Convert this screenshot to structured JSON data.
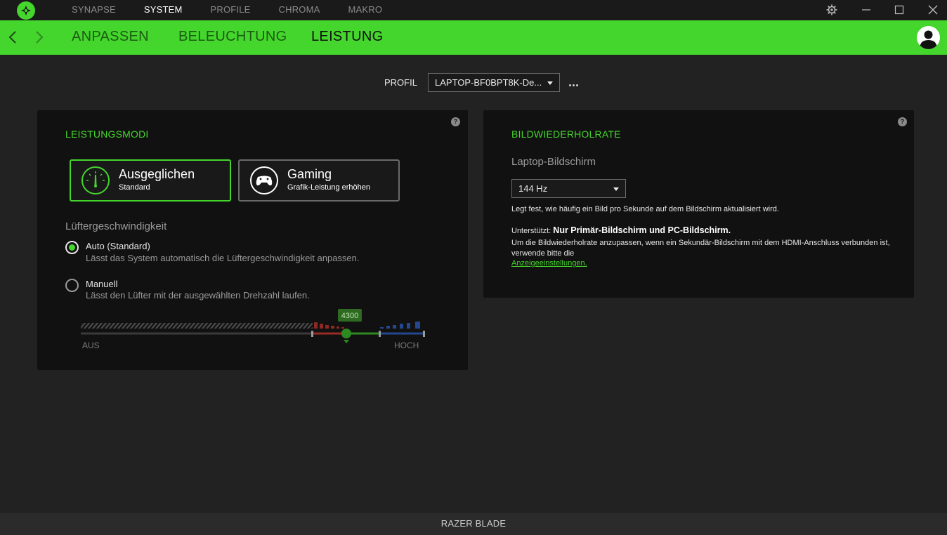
{
  "topnav": {
    "items": [
      "SYNAPSE",
      "SYSTEM",
      "PROFILE",
      "CHROMA",
      "MAKRO"
    ],
    "active": "SYSTEM"
  },
  "subnav": {
    "tabs": [
      "ANPASSEN",
      "BELEUCHTUNG",
      "LEISTUNG"
    ],
    "active": "LEISTUNG"
  },
  "profile": {
    "label": "PROFIL",
    "value": "LAPTOP-BF0BPT8K-De..."
  },
  "left": {
    "title": "LEISTUNGSMODI",
    "help": "?",
    "modes": [
      {
        "name": "Ausgeglichen",
        "sub": "Standard",
        "icon": "speedometer-icon",
        "selected": true
      },
      {
        "name": "Gaming",
        "sub": "Grafik-Leistung erhöhen",
        "icon": "gamepad-icon",
        "selected": false
      }
    ],
    "fan_label": "Lüftergeschwindigkeit",
    "options": [
      {
        "label": "Auto (Standard)",
        "desc": "Lässt das System automatisch die Lüftergeschwindigkeit anpassen.",
        "checked": true
      },
      {
        "label": "Manuell",
        "desc": "Lässt den Lüfter mit der ausgewählten Drehzahl laufen.",
        "checked": false
      }
    ],
    "slider": {
      "value": "4300",
      "min_label": "AUS",
      "max_label": "HOCH"
    }
  },
  "right": {
    "title": "BILDWIEDERHOLRATE",
    "help": "?",
    "screen_label": "Laptop-Bildschirm",
    "refresh_value": "144 Hz",
    "desc": "Legt fest, wie häufig ein Bild pro Sekunde auf dem Bildschirm aktualisiert wird.",
    "supported_prefix": "Unterstützt: ",
    "supported_value": "Nur Primär-Bildschirm und PC-Bildschirm.",
    "note": "Um die Bildwiederholrate anzupassen, wenn ein Sekundär-Bildschirm mit dem HDMI-Anschluss verbunden ist, verwende bitte die",
    "link": "Anzeigeeinstellungen."
  },
  "footer": {
    "device": "RAZER BLADE"
  },
  "colors": {
    "accent": "#44d62c",
    "background": "#222222",
    "panel": "#111111"
  }
}
